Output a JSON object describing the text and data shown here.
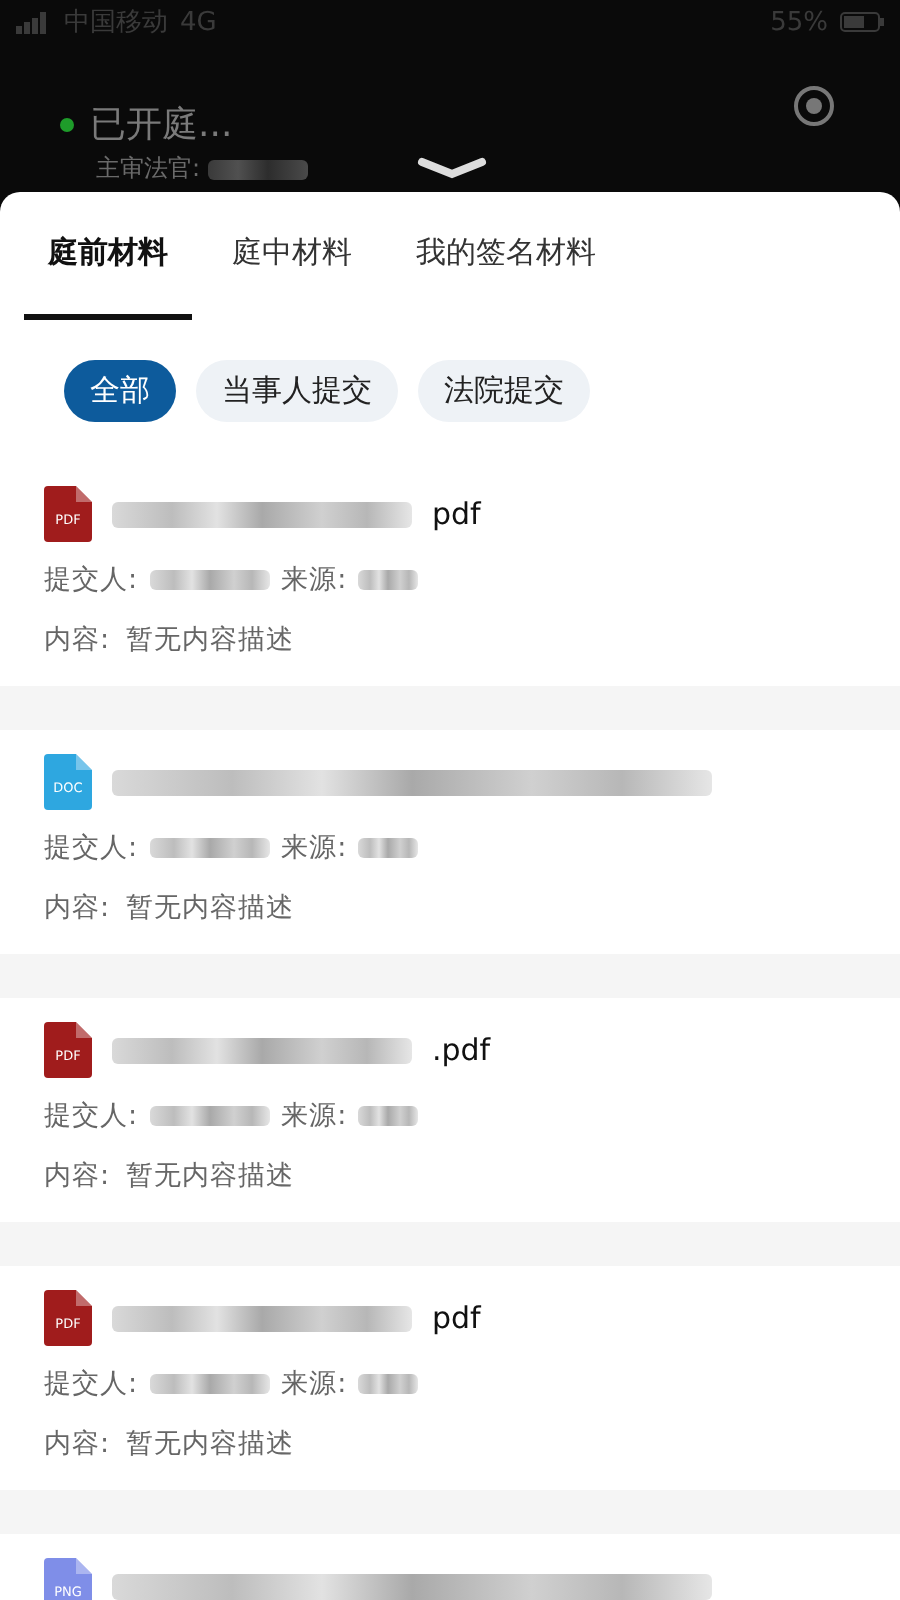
{
  "status_bar": {
    "carrier": "中国移动",
    "network": "4G",
    "battery": "55%"
  },
  "header": {
    "status": "已开庭...",
    "color": "#1e9c2a",
    "judge_label": "主审法官:"
  },
  "tabs": [
    {
      "label": "庭前材料",
      "selected": true
    },
    {
      "label": "庭中材料",
      "selected": false
    },
    {
      "label": "我的签名材料",
      "selected": false
    }
  ],
  "filters": [
    {
      "label": "全部",
      "selected": true
    },
    {
      "label": "当事人提交",
      "selected": false
    },
    {
      "label": "法院提交",
      "selected": false
    }
  ],
  "files": [
    {
      "kind": "pdf",
      "icon_label": "PDF",
      "name_visible": "pdf",
      "submitter_label": "提交人:",
      "source_label": "来源:",
      "content": "内容:  暂无内容描述"
    },
    {
      "kind": "doc",
      "icon_label": "DOC",
      "submitter_label": "提交人:",
      "source_label": "来源:",
      "content": "内容:  暂无内容描述"
    },
    {
      "kind": "pdf",
      "icon_label": "PDF",
      "name_visible": ".pdf",
      "submitter_label": "提交人:",
      "source_label": "来源:",
      "content": "内容:  暂无内容描述"
    },
    {
      "kind": "pdf",
      "icon_label": "PDF",
      "name_visible": "pdf",
      "submitter_label": "提交人:",
      "source_label": "来源:",
      "content": "内容:  暂无内容描述"
    },
    {
      "kind": "png",
      "icon_label": "PNG"
    }
  ]
}
